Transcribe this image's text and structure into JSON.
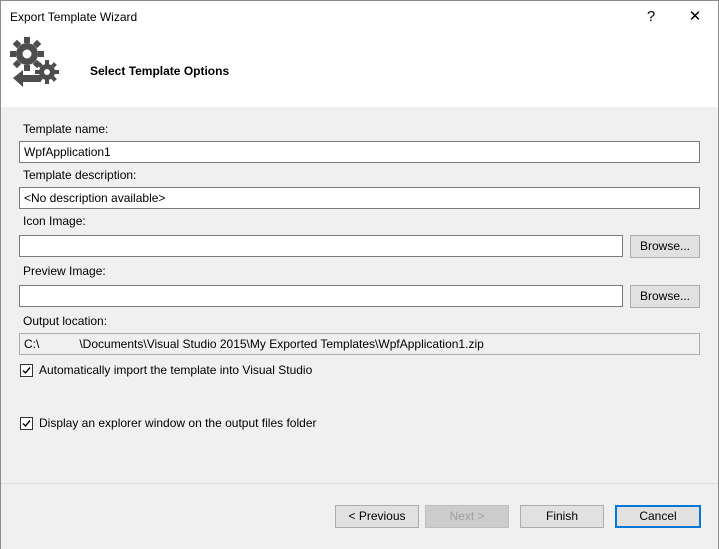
{
  "window": {
    "title": "Export Template Wizard",
    "help_button": "?",
    "close_button": "✕"
  },
  "header": {
    "icon": "gears-export-icon",
    "title": "Select Template Options"
  },
  "form": {
    "template_name_label": "Template name:",
    "template_name_value": "WpfApplication1",
    "template_description_label": "Template description:",
    "template_description_value": "<No description available>",
    "icon_image_label": "Icon Image:",
    "icon_image_value": "",
    "icon_browse_label": "Browse...",
    "preview_image_label": "Preview Image:",
    "preview_image_value": "",
    "preview_browse_label": "Browse...",
    "output_location_label": "Output location:",
    "output_location_value": "C:\\            \\Documents\\Visual Studio 2015\\My Exported Templates\\WpfApplication1.zip",
    "auto_import_label": "Automatically import the template into Visual Studio",
    "auto_import_checked": true,
    "explorer_label": "Display an explorer window on the output files folder",
    "explorer_checked": true
  },
  "footer": {
    "previous_label": "< Previous",
    "next_label": "Next >",
    "finish_label": "Finish",
    "cancel_label": "Cancel"
  },
  "colors": {
    "accent": "#0078d7",
    "window_bg": "#f0f0f0",
    "header_bg": "#ffffff",
    "logo_gray": "#4d4d4d"
  }
}
